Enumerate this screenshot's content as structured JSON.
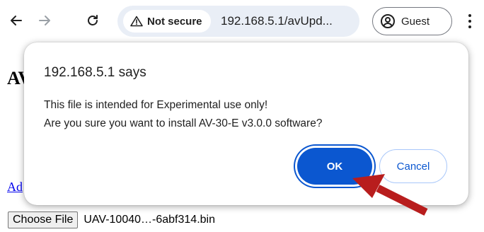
{
  "browser": {
    "security_label": "Not secure",
    "url": "192.168.5.1/avUpd...",
    "profile_label": "Guest",
    "icons": {
      "back": "arrow-left-icon",
      "forward": "arrow-right-icon",
      "reload": "reload-icon",
      "warning": "warning-triangle-icon",
      "profile": "profile-avatar-icon",
      "menu": "kebab-menu-icon"
    }
  },
  "page": {
    "heading_partial": "AV",
    "link_partial": "Ad",
    "file_input": {
      "button_label": "Choose File",
      "file_name": "UAV-10040…-6abf314.bin"
    }
  },
  "dialog": {
    "title": "192.168.5.1 says",
    "message_line1": "This file is intended for Experimental use only!",
    "message_line2": "Are you sure you want to install AV-30-E v3.0.0 software?",
    "ok_label": "OK",
    "cancel_label": "Cancel"
  },
  "colors": {
    "ok_button": "#0b57d0",
    "annotation_arrow": "#b81d1d"
  }
}
